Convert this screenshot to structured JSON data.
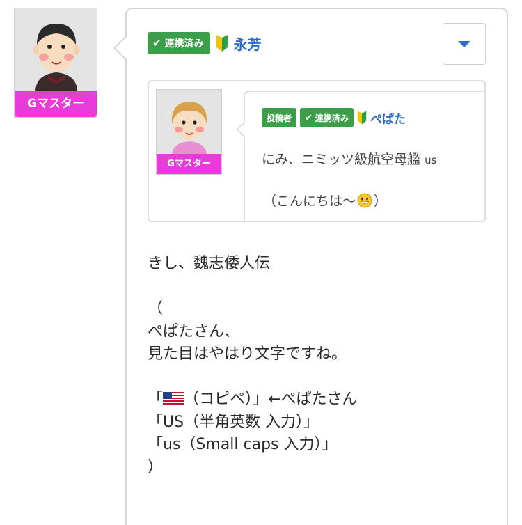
{
  "main_user": {
    "rank": "Gマスター",
    "linked_badge": "連携済み",
    "name": "永芳"
  },
  "quote": {
    "rank": "Gマスター",
    "poster_badge": "投稿者",
    "linked_badge": "連携済み",
    "name": "ぺぱた",
    "line1_main": "にみ、ニミッツ級航空母艦",
    "line1_small": "us",
    "line2_open": "（こんにちは〜",
    "line2_close": "）"
  },
  "body": {
    "line1": "きし、魏志倭人伝",
    "line2": "（",
    "line3": "ぺぱたさん、",
    "line4": "見た目はやはり文字ですね。",
    "line5_open": "「",
    "line5_rest": "（コピペ）」←ぺぱたさん",
    "line6": "「US（半角英数 入力）」",
    "line7": "「us（Small caps 入力）」",
    "line8": "）"
  },
  "icons": {
    "linked": "check-leaf-icon",
    "beginner": "beginner-mark-icon",
    "menu": "dropdown-caret-icon",
    "smile": "grinning-face-emoji",
    "flag": "us-flag-emoji"
  },
  "colors": {
    "badge_green": "#3d9e4a",
    "rank_magenta": "#e83bd9",
    "link_blue": "#2b6cc4"
  }
}
